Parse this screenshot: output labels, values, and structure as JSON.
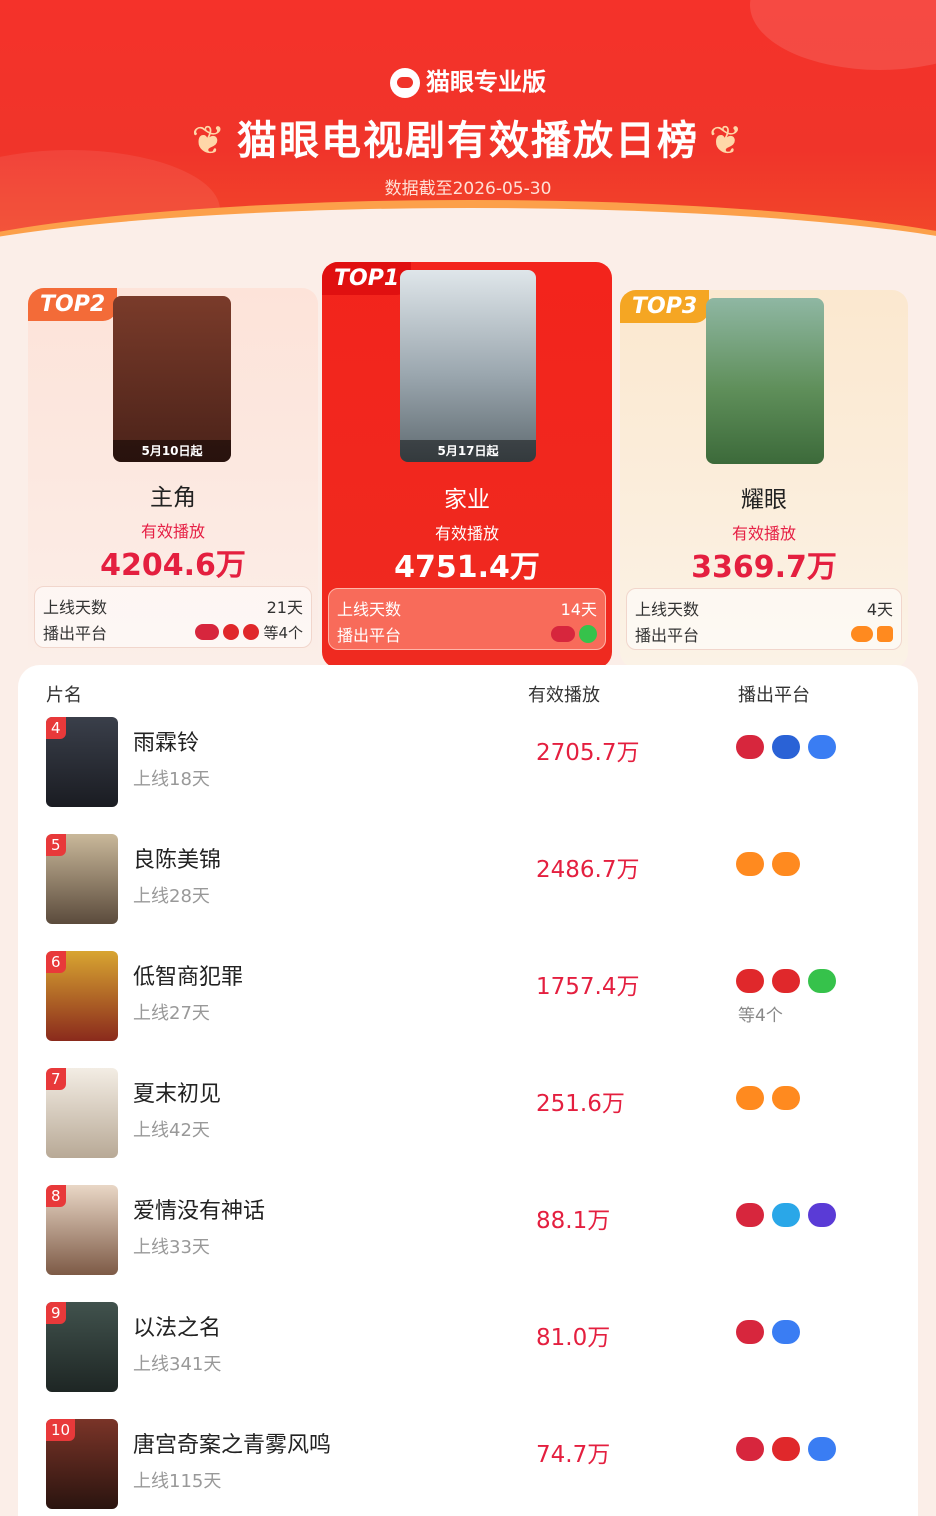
{
  "header": {
    "brand": "猫眼专业版",
    "title": "猫眼电视剧有效播放日榜",
    "date": "数据截至2026-05-30"
  },
  "top": [
    {
      "tag": "TOP1",
      "name": "家业",
      "label": "有效播放",
      "value": "4751.4万",
      "days_label": "上线天数",
      "days": "14天",
      "platform_label": "播出平台",
      "poster_text": "5月17日起",
      "platforms": [
        "CCTV8",
        "iQIYI"
      ],
      "more": ""
    },
    {
      "tag": "TOP2",
      "name": "主角",
      "label": "有效播放",
      "value": "4204.6万",
      "days_label": "上线天数",
      "days": "21天",
      "platform_label": "播出平台",
      "poster_text": "5月10日起",
      "platforms": [
        "CCTV",
        "卫视",
        "咪咕"
      ],
      "more": "等4个"
    },
    {
      "tag": "TOP3",
      "name": "耀眼",
      "label": "有效播放",
      "value": "3369.7万",
      "days_label": "上线天数",
      "days": "4天",
      "platform_label": "播出平台",
      "poster_text": "",
      "platforms": [
        "芒果",
        "芒果TV"
      ],
      "more": ""
    }
  ],
  "list_headers": {
    "name": "片名",
    "value": "有效播放",
    "platform": "播出平台"
  },
  "rows": [
    {
      "rank": "4",
      "name": "雨霖铃",
      "days": "上线18天",
      "value": "2705.7万",
      "platforms": [
        "CCTV8",
        "浙江",
        "优酷"
      ],
      "more": ""
    },
    {
      "rank": "5",
      "name": "良陈美锦",
      "days": "上线28天",
      "value": "2486.7万",
      "platforms": [
        "芒果",
        "芒果TV"
      ],
      "more": ""
    },
    {
      "rank": "6",
      "name": "低智商犯罪",
      "days": "上线27天",
      "value": "1757.4万",
      "platforms": [
        "江苏",
        "东方",
        "iQIYI"
      ],
      "more": "等4个"
    },
    {
      "rank": "7",
      "name": "夏末初见",
      "days": "上线42天",
      "value": "251.6万",
      "platforms": [
        "芒果",
        "芒果TV"
      ],
      "more": ""
    },
    {
      "rank": "8",
      "name": "爱情没有神话",
      "days": "上线33天",
      "value": "88.1万",
      "platforms": [
        "CCTV8",
        "腾讯",
        "咪咕"
      ],
      "more": ""
    },
    {
      "rank": "9",
      "name": "以法之名",
      "days": "上线341天",
      "value": "81.0万",
      "platforms": [
        "CCTV8",
        "优酷"
      ],
      "more": ""
    },
    {
      "rank": "10",
      "name": "唐宫奇案之青雾风鸣",
      "days": "上线115天",
      "value": "74.7万",
      "platforms": [
        "CCTV8",
        "东方",
        "优酷"
      ],
      "more": ""
    }
  ],
  "colors": {
    "accent": "#e41f3f",
    "header_red": "#f0342a",
    "top2_tag": "#f36b38",
    "top3_tag": "#f5a623"
  }
}
